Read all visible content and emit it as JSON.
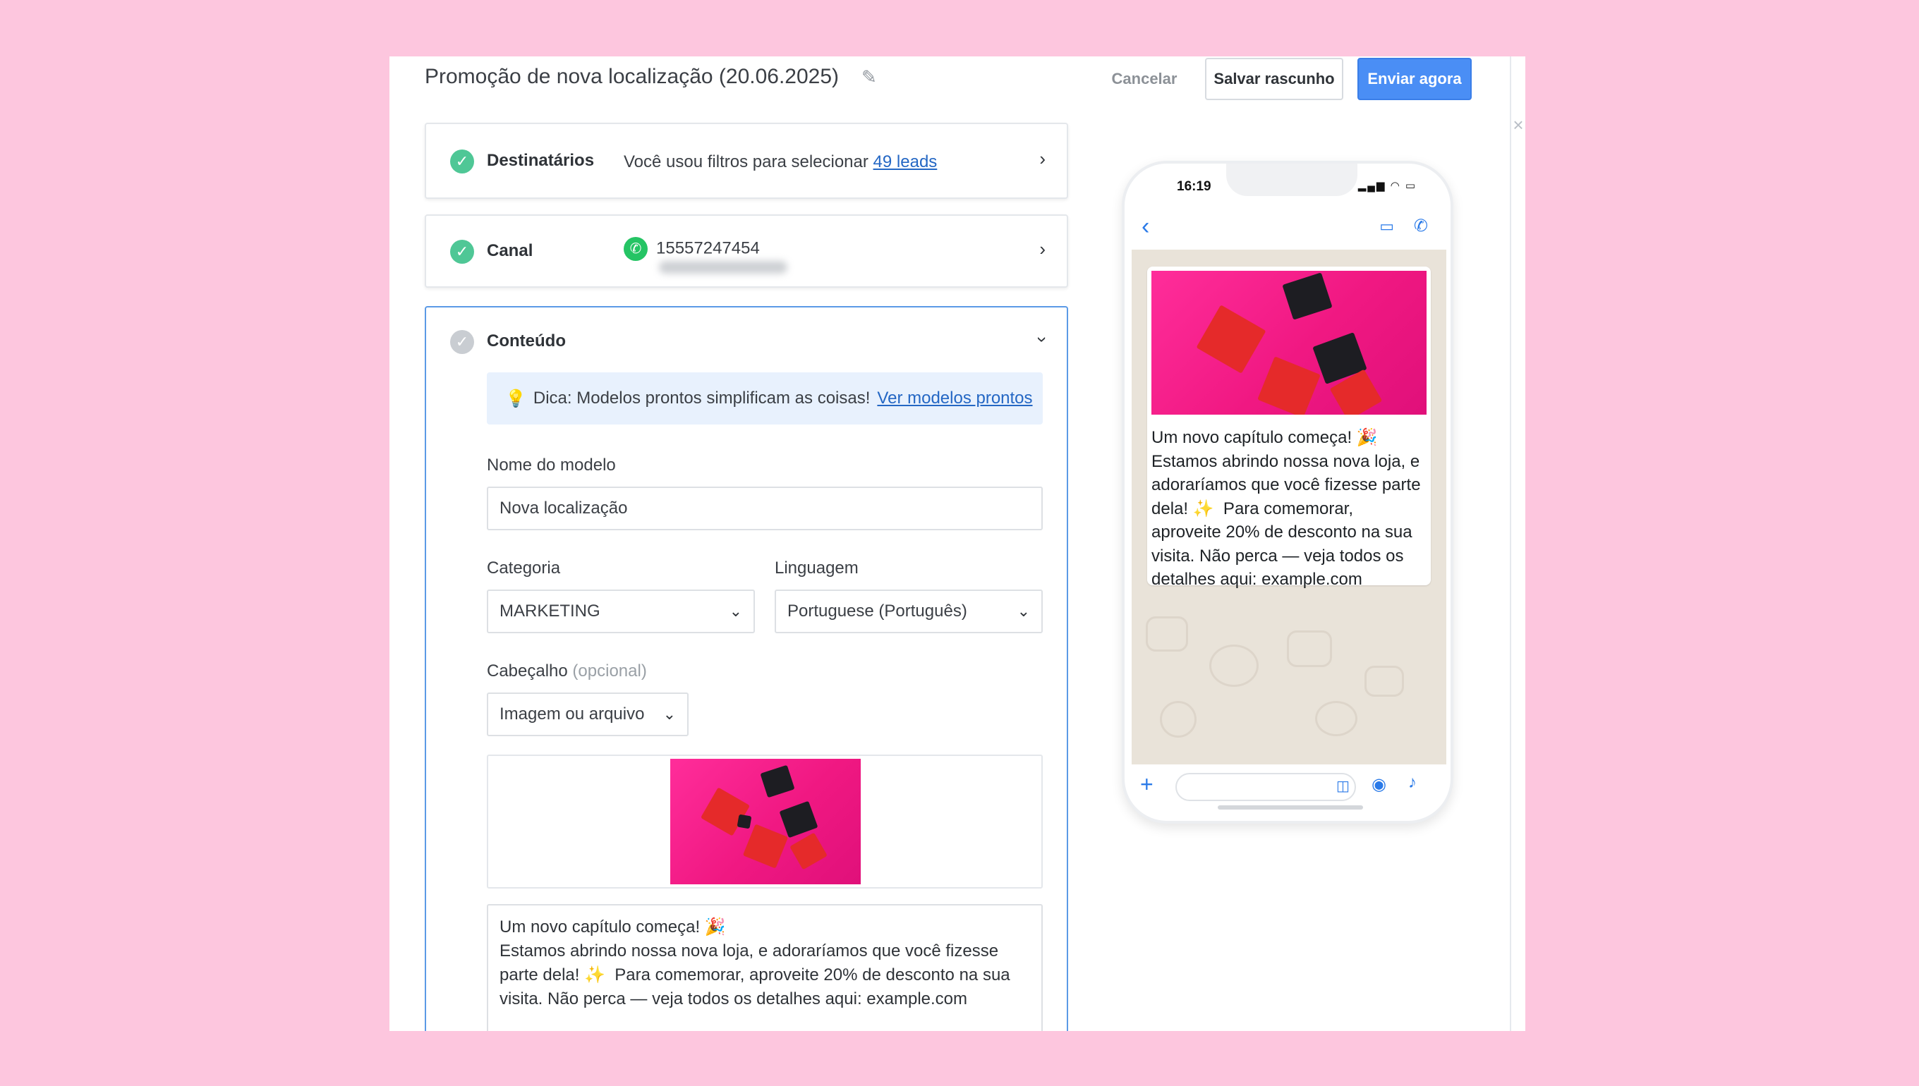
{
  "header": {
    "title": "Promoção de nova localização (20.06.2025)",
    "cancel_label": "Cancelar",
    "draft_label": "Salvar rascunho",
    "send_label": "Enviar agora"
  },
  "recipients": {
    "label": "Destinatários",
    "text": "Você usou filtros para selecionar",
    "link": "49 leads"
  },
  "channel": {
    "label": "Canal",
    "phone": "15557247454"
  },
  "content": {
    "label": "Conteúdo",
    "tip_text": "Dica: Modelos prontos simplificam as coisas!",
    "tip_link": "Ver modelos prontos",
    "template_name_label": "Nome do modelo",
    "template_name_value": "Nova localização",
    "category_label": "Categoria",
    "category_value": "MARKETING",
    "language_label": "Linguagem",
    "language_value": "Portuguese (Português)",
    "header_label": "Cabeçalho",
    "header_optional": "(opcional)",
    "header_type_value": "Imagem ou arquivo",
    "message_lines": [
      "Um novo capítulo começa! 🎉",
      "Estamos abrindo nossa nova loja, e adoraríamos que você fizesse",
      "parte dela! ✨  Para comemorar, aproveite 20% de desconto na sua",
      "visita. Não perca — veja todos os detalhes aqui: example.com"
    ]
  },
  "preview": {
    "time": "16:19",
    "bubble_lines": [
      "Um novo capítulo começa! 🎉",
      "Estamos abrindo nossa nova loja, e",
      "adoraríamos que você fizesse parte",
      "dela! ✨  Para comemorar,",
      "aproveite 20% de desconto na sua",
      "visita. Não perca — veja todos os",
      "detalhes aqui: example.com"
    ]
  },
  "icons": {
    "edit": "pencil-icon",
    "check": "check-circle-icon",
    "chevron_right": "chevron-right-icon",
    "chevron_down": "chevron-down-icon",
    "whatsapp": "whatsapp-icon",
    "tip": "lightbulb-icon",
    "close": "close-icon"
  },
  "colors": {
    "background": "#fdc6de",
    "primary": "#4a8ef5",
    "success": "#4fc796",
    "link": "#2467c4",
    "gift_bg": "#f01882"
  }
}
